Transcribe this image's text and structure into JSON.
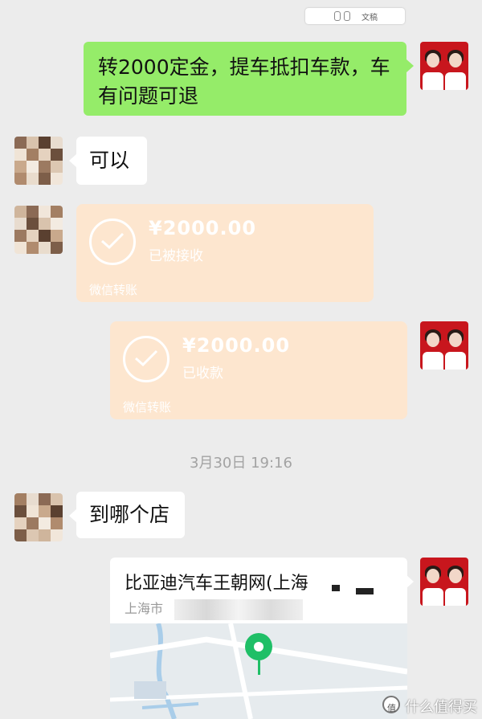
{
  "top_pill": {
    "label": "文稿"
  },
  "messages": {
    "m1_text": "转2000定金，提车抵扣车款，车有问题可退",
    "m2_text": "可以",
    "transfer1": {
      "amount": "¥2000.00",
      "status": "已被接收",
      "footer": "微信转账"
    },
    "transfer2": {
      "amount": "¥2000.00",
      "status": "已收款",
      "footer": "微信转账"
    },
    "timestamp": "3月30日 19:16",
    "m3_text": "到哪个店",
    "location": {
      "title": "比亚迪汽车王朝网(上海",
      "address": "上海市"
    }
  },
  "watermark": {
    "text": "什么值得买"
  },
  "colors": {
    "my_bubble": "#95ec69",
    "transfer_card": "#fde6cf",
    "background": "#ececec"
  }
}
